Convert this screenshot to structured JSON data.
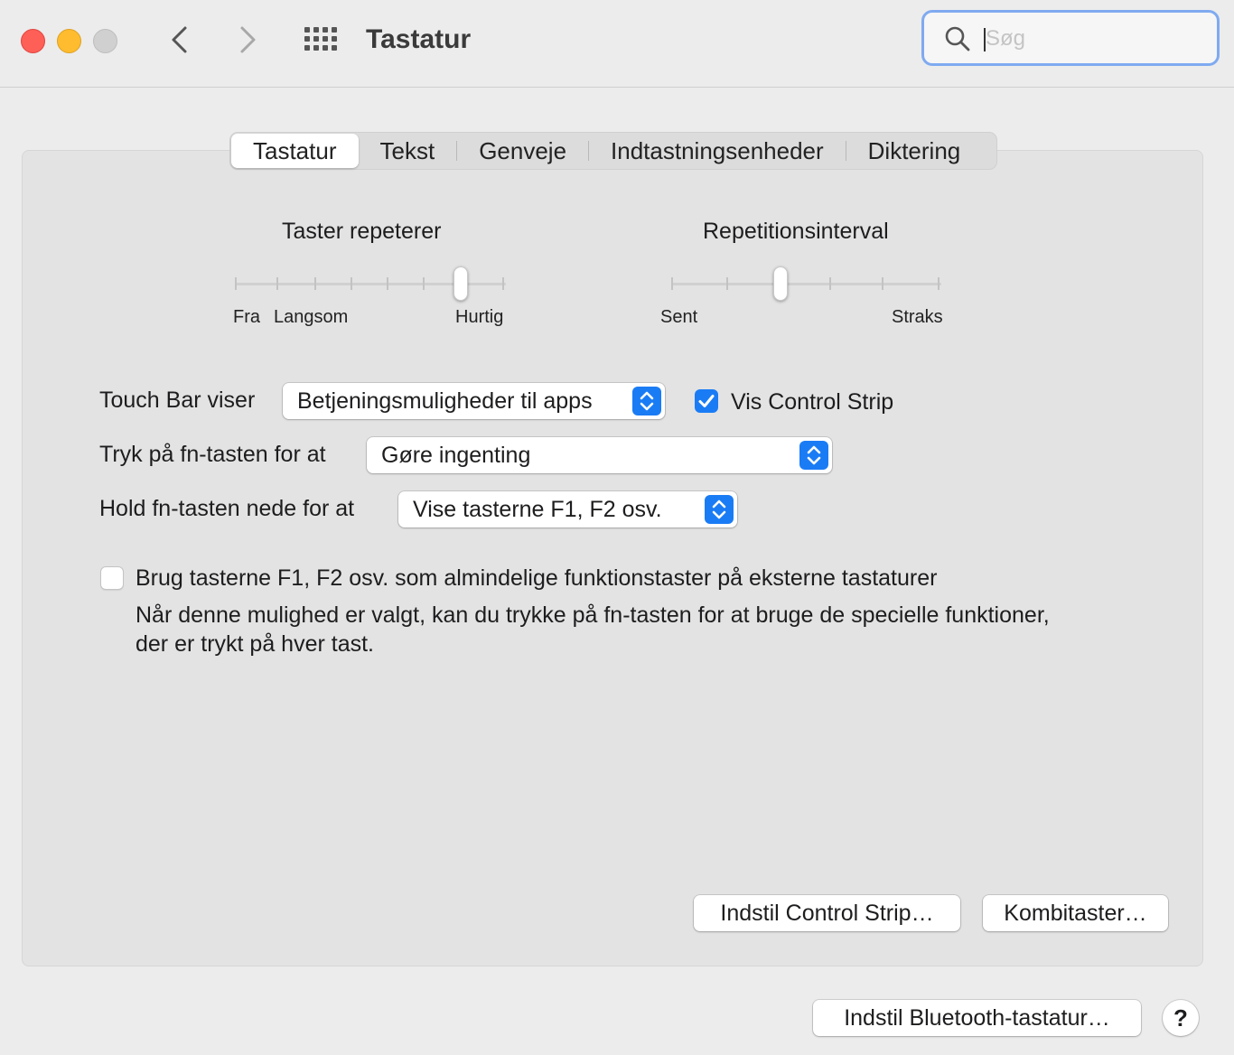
{
  "window": {
    "title": "Tastatur",
    "search_placeholder": "Søg",
    "search_value": ""
  },
  "tabs": [
    {
      "label": "Tastatur",
      "active": true
    },
    {
      "label": "Tekst",
      "active": false
    },
    {
      "label": "Genveje",
      "active": false
    },
    {
      "label": "Indtastningsenheder",
      "active": false
    },
    {
      "label": "Diktering",
      "active": false
    }
  ],
  "key_repeat": {
    "title": "Taster repeterer",
    "labels": [
      "Fra",
      "Langsom",
      "Hurtig"
    ],
    "ticks": 8,
    "value_index": 6
  },
  "repeat_delay": {
    "title": "Repetitionsinterval",
    "labels": [
      "Sent",
      "Straks"
    ],
    "ticks": 6,
    "value_index": 2
  },
  "touch_bar": {
    "label": "Touch Bar viser",
    "value": "Betjeningsmuligheder til apps",
    "control_strip_label": "Vis Control Strip",
    "control_strip_checked": true
  },
  "fn_press": {
    "label": "Tryk på fn-tasten for at",
    "value": "Gøre ingenting"
  },
  "fn_hold": {
    "label": "Hold fn-tasten nede for at",
    "value": "Vise tasterne F1, F2 osv."
  },
  "function_keys": {
    "checked": false,
    "label": "Brug tasterne F1, F2 osv. som almindelige funktionstaster på eksterne tastaturer",
    "description_line1": "Når denne mulighed er valgt, kan du trykke på fn-tasten for at bruge de specielle funktioner,",
    "description_line2": "der er trykt på hver tast."
  },
  "buttons": {
    "control_strip": "Indstil Control Strip…",
    "modifier_keys": "Kombitaster…",
    "bluetooth": "Indstil Bluetooth-tastatur…",
    "help": "?"
  },
  "colors": {
    "accent": "#1a7cf5",
    "traffic_red": "#fe5f57",
    "traffic_yellow": "#febc2e"
  }
}
